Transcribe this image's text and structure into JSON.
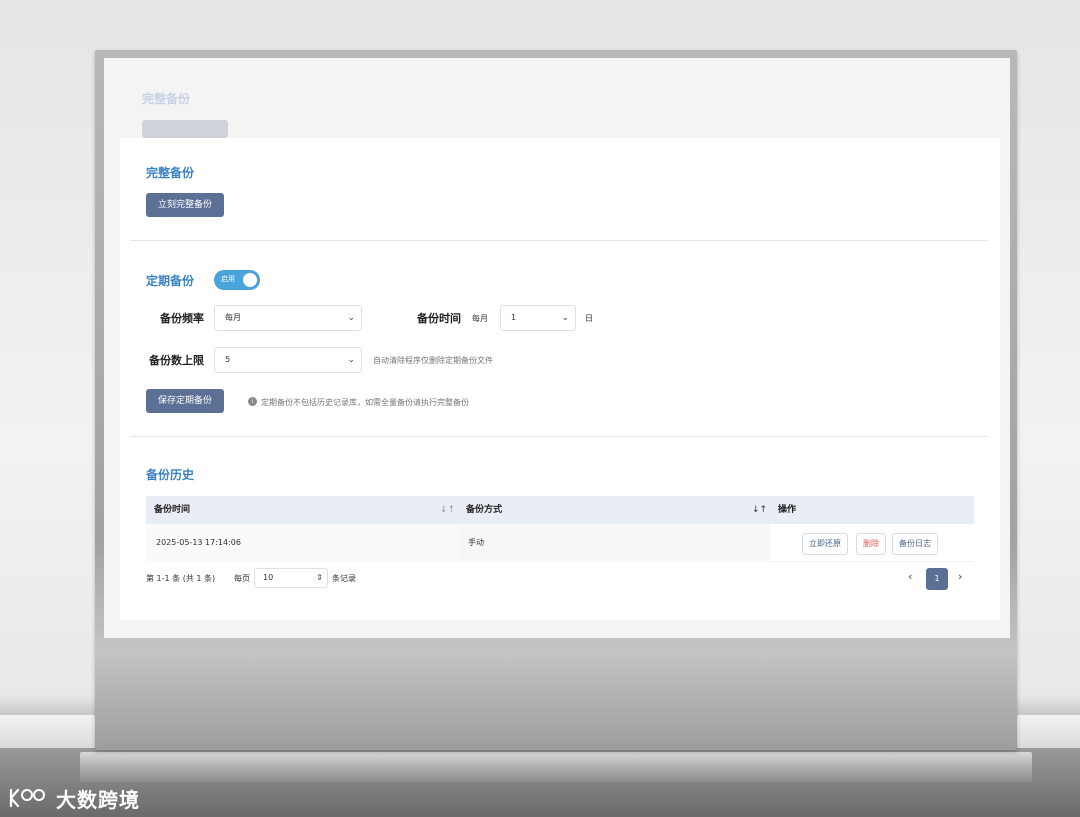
{
  "ghost": {
    "title": "完整备份"
  },
  "full_backup": {
    "title": "完整备份",
    "button_label": "立刻完整备份"
  },
  "scheduled": {
    "title": "定期备份",
    "toggle_label": "启用",
    "toggle_on": true,
    "frequency_label": "备份频率",
    "frequency_value": "每月",
    "time_label": "备份时间",
    "time_prefix": "每月",
    "time_value": "1",
    "time_suffix": "日",
    "limit_label": "备份数上限",
    "limit_value": "5",
    "limit_hint": "自动清除程序仅删除定期备份文件",
    "save_button": "保存定期备份",
    "save_hint": "定期备份不包括历史记录库，如需全量备份请执行完整备份"
  },
  "history": {
    "title": "备份历史",
    "columns": [
      "备份时间",
      "备份方式",
      "操作"
    ],
    "rows": [
      {
        "time": "2025-05-13 17:14:06",
        "method": "手动",
        "actions": [
          "立即还原",
          "删除",
          "备份日志"
        ]
      }
    ],
    "pager": {
      "summary": "第 1-1 条 (共 1 条)",
      "per_page_label": "每页",
      "per_page_value": "10",
      "per_page_suffix": "条记录",
      "current_page": "1"
    }
  },
  "watermark": {
    "text": "大数跨境"
  },
  "colors": {
    "accent_blue": "#3b82c4",
    "primary_button": "#5c6f95",
    "toggle_on": "#4aa3d9",
    "danger": "#e25b5b"
  }
}
